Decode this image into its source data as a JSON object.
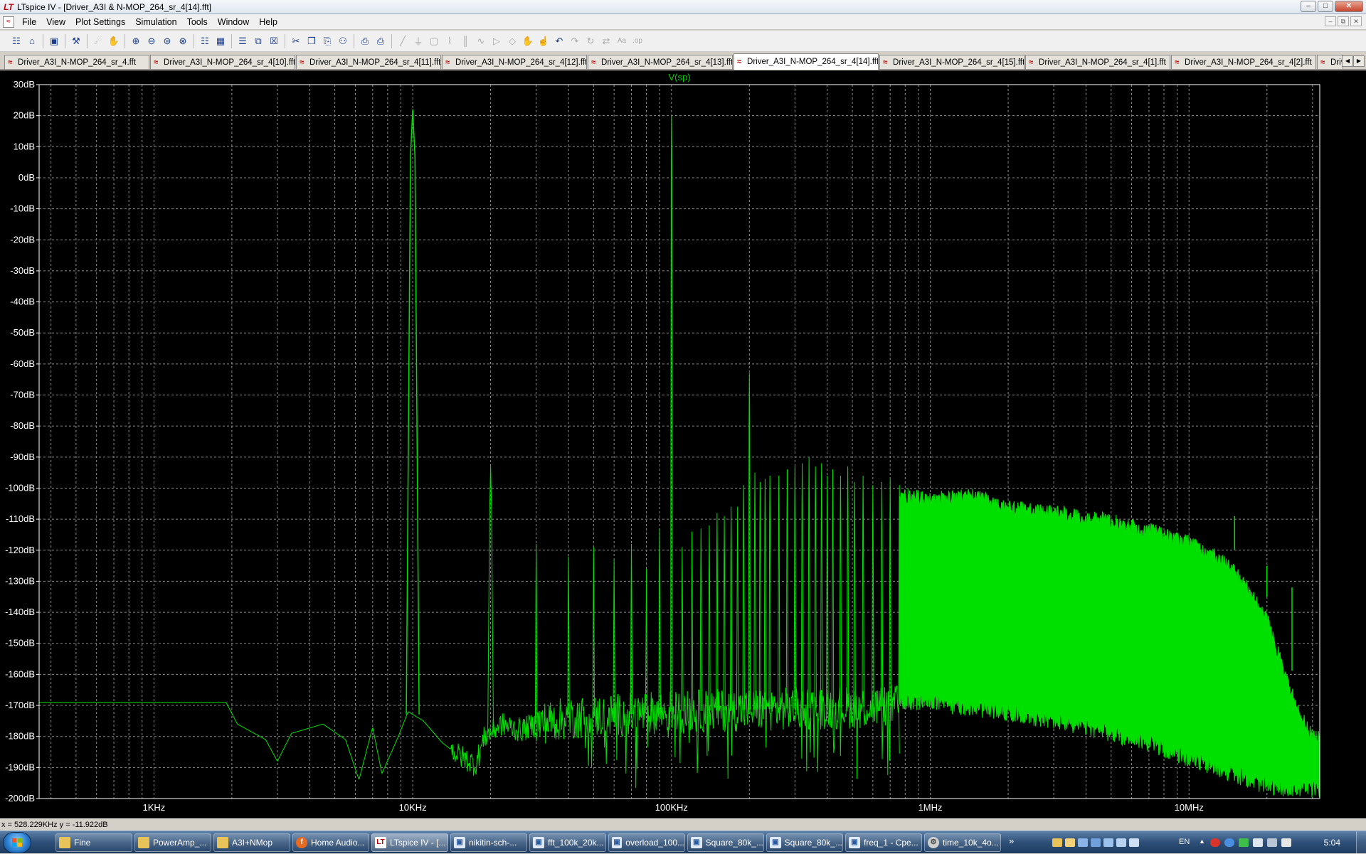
{
  "window": {
    "title": "LTspice IV - [Driver_A3I & N-MOP_264_sr_4[14].fft]",
    "app_icon": "ltspice-logo-icon"
  },
  "menu": [
    "File",
    "View",
    "Plot Settings",
    "Simulation",
    "Tools",
    "Window",
    "Help"
  ],
  "toolbar": {
    "groups": [
      [
        "new-schematic-icon",
        "open-icon"
      ],
      [
        "save-icon"
      ],
      [
        "control-panel-icon"
      ],
      [
        "run-icon",
        "halt-icon"
      ],
      [
        "zoom-in-icon",
        "zoom-out-icon",
        "zoom-fit-icon",
        "zoom-cancel-icon"
      ],
      [
        "autorange-icon",
        "grid-icon"
      ],
      [
        "tile-horizontal-icon",
        "cascade-icon",
        "close-all-icon"
      ],
      [
        "cut-icon",
        "copy-icon",
        "paste-icon",
        "find-icon"
      ],
      [
        "print-icon",
        "print-setup-icon"
      ],
      [
        "wire-icon",
        "ground-icon",
        "label-icon",
        "resistor-icon",
        "capacitor-icon",
        "inductor-icon",
        "diode-icon",
        "component-icon",
        "move-icon",
        "drag-icon",
        "undo-icon",
        "redo-icon",
        "rotate-icon",
        "mirror-icon",
        "text-icon",
        "spice-directive-icon"
      ]
    ],
    "dim_icons": [
      "run-icon",
      "halt-icon",
      "wire-icon",
      "ground-icon",
      "label-icon",
      "resistor-icon",
      "capacitor-icon",
      "inductor-icon",
      "diode-icon",
      "component-icon",
      "move-icon",
      "drag-icon",
      "redo-icon",
      "rotate-icon",
      "mirror-icon",
      "text-icon",
      "spice-directive-icon"
    ]
  },
  "tabs": [
    {
      "label": "Driver_A3I_N-MOP_264_sr_4.fft",
      "active": false
    },
    {
      "label": "Driver_A3I_N-MOP_264_sr_4[10].fft",
      "active": false
    },
    {
      "label": "Driver_A3I_N-MOP_264_sr_4[11].fft",
      "active": false
    },
    {
      "label": "Driver_A3I_N-MOP_264_sr_4[12].fft",
      "active": false
    },
    {
      "label": "Driver_A3I_N-MOP_264_sr_4[13].fft",
      "active": false
    },
    {
      "label": "Driver_A3I_N-MOP_264_sr_4[14].fft",
      "active": true
    },
    {
      "label": "Driver_A3I_N-MOP_264_sr_4[15].fft",
      "active": false
    },
    {
      "label": "Driver_A3I_N-MOP_264_sr_4[1].fft",
      "active": false
    },
    {
      "label": "Driver_A3I_N-MOP_264_sr_4[2].fft",
      "active": false
    },
    {
      "label": "Driver_...",
      "active": false
    }
  ],
  "chart_data": {
    "type": "line",
    "title": "V(sp)",
    "xlabel": "",
    "ylabel": "",
    "x_scale": "log",
    "xlim_hz": [
      360,
      32000000
    ],
    "ylim_db": [
      -200,
      30
    ],
    "xticks": [
      {
        "value": 1000,
        "label": "1KHz"
      },
      {
        "value": 10000,
        "label": "10KHz"
      },
      {
        "value": 100000,
        "label": "100KHz"
      },
      {
        "value": 1000000,
        "label": "1MHz"
      },
      {
        "value": 10000000,
        "label": "10MHz"
      }
    ],
    "yticks": [
      {
        "value": 30,
        "label": "30dB"
      },
      {
        "value": 20,
        "label": "20dB"
      },
      {
        "value": 10,
        "label": "10dB"
      },
      {
        "value": 0,
        "label": "0dB"
      },
      {
        "value": -10,
        "label": "-10dB"
      },
      {
        "value": -20,
        "label": "-20dB"
      },
      {
        "value": -30,
        "label": "-30dB"
      },
      {
        "value": -40,
        "label": "-40dB"
      },
      {
        "value": -50,
        "label": "-50dB"
      },
      {
        "value": -60,
        "label": "-60dB"
      },
      {
        "value": -70,
        "label": "-70dB"
      },
      {
        "value": -80,
        "label": "-80dB"
      },
      {
        "value": -90,
        "label": "-90dB"
      },
      {
        "value": -100,
        "label": "-100dB"
      },
      {
        "value": -110,
        "label": "-110dB"
      },
      {
        "value": -120,
        "label": "-120dB"
      },
      {
        "value": -130,
        "label": "-130dB"
      },
      {
        "value": -140,
        "label": "-140dB"
      },
      {
        "value": -150,
        "label": "-150dB"
      },
      {
        "value": -160,
        "label": "-160dB"
      },
      {
        "value": -170,
        "label": "-170dB"
      },
      {
        "value": -180,
        "label": "-180dB"
      },
      {
        "value": -190,
        "label": "-190dB"
      },
      {
        "value": -200,
        "label": "-200dB"
      }
    ],
    "grid": true,
    "colors": {
      "background": "#000000",
      "trace": "#00e000",
      "grid": "#8a8a8a",
      "axis_text": "#ffffff",
      "title": "#00d000"
    },
    "series": [
      {
        "name": "V(sp)",
        "noise_floor": [
          [
            360,
            -169
          ],
          [
            1000,
            -169
          ],
          [
            1900,
            -169
          ],
          [
            2100,
            -176
          ],
          [
            2700,
            -181
          ],
          [
            3000,
            -188
          ],
          [
            3400,
            -179
          ],
          [
            4500,
            -176
          ],
          [
            5500,
            -181
          ],
          [
            6200,
            -194
          ],
          [
            7000,
            -177
          ],
          [
            7600,
            -192
          ],
          [
            8800,
            -180
          ],
          [
            9600,
            -172
          ],
          [
            11000,
            -175
          ],
          [
            13000,
            -182
          ],
          [
            15000,
            -186
          ],
          [
            17500,
            -189
          ],
          [
            19000,
            -180
          ],
          [
            22000,
            -176
          ],
          [
            26000,
            -178
          ],
          [
            30000,
            -176
          ],
          [
            40000,
            -174
          ],
          [
            100000,
            -172
          ],
          [
            300000,
            -171
          ],
          [
            1000000,
            -170
          ],
          [
            3000000,
            -170
          ],
          [
            10000000,
            -170
          ],
          [
            20000000,
            -174
          ],
          [
            32000000,
            -182
          ]
        ],
        "harmonic_peaks": [
          [
            10000,
            22
          ],
          [
            20000,
            -93
          ],
          [
            30000,
            -118
          ],
          [
            40000,
            -122
          ],
          [
            50000,
            -119
          ],
          [
            60000,
            -123
          ],
          [
            70000,
            -118
          ],
          [
            80000,
            -126
          ],
          [
            90000,
            -113
          ],
          [
            100000,
            20
          ],
          [
            110000,
            -119
          ],
          [
            120000,
            -114
          ],
          [
            130000,
            -113
          ],
          [
            140000,
            -112
          ],
          [
            150000,
            -108
          ],
          [
            160000,
            -109
          ],
          [
            170000,
            -106
          ],
          [
            180000,
            -106
          ],
          [
            190000,
            -99
          ],
          [
            200000,
            -63
          ],
          [
            210000,
            -95
          ],
          [
            220000,
            -98
          ],
          [
            230000,
            -97
          ],
          [
            240000,
            -96
          ],
          [
            260000,
            -96
          ],
          [
            280000,
            -94
          ],
          [
            300000,
            -93
          ],
          [
            320000,
            -92
          ],
          [
            340000,
            -90
          ],
          [
            360000,
            -93
          ],
          [
            380000,
            -92
          ],
          [
            400000,
            -96
          ],
          [
            420000,
            -94
          ],
          [
            450000,
            -96
          ],
          [
            480000,
            -93
          ],
          [
            510000,
            -98
          ],
          [
            550000,
            -96
          ],
          [
            600000,
            -99
          ],
          [
            650000,
            -98
          ],
          [
            700000,
            -97
          ],
          [
            760000,
            -99
          ],
          [
            820000,
            -100
          ],
          [
            890000,
            -101
          ],
          [
            960000,
            -102
          ]
        ],
        "dense_band_top": [
          [
            760000,
            -100
          ],
          [
            1000000,
            -101
          ],
          [
            1500000,
            -100
          ],
          [
            2000000,
            -104
          ],
          [
            3000000,
            -105
          ],
          [
            4000000,
            -107
          ],
          [
            5000000,
            -108
          ],
          [
            7000000,
            -111
          ],
          [
            10000000,
            -115
          ],
          [
            13000000,
            -120
          ],
          [
            16000000,
            -127
          ],
          [
            20000000,
            -140
          ],
          [
            23000000,
            -155
          ],
          [
            26000000,
            -168
          ],
          [
            30000000,
            -178
          ]
        ],
        "dense_band_bottom": [
          [
            760000,
            -172
          ],
          [
            1000000,
            -172
          ],
          [
            2000000,
            -175
          ],
          [
            4000000,
            -180
          ],
          [
            7000000,
            -185
          ],
          [
            10000000,
            -190
          ],
          [
            15000000,
            -195
          ],
          [
            20000000,
            -199
          ],
          [
            32000000,
            -200
          ]
        ],
        "spurs": [
          [
            15000000,
            -109
          ],
          [
            20000000,
            -125
          ],
          [
            25000000,
            -132
          ]
        ]
      }
    ]
  },
  "statusbar": {
    "cursor_text": "x = 528.229KHz    y = -11.922dB"
  },
  "taskbar": {
    "items": [
      {
        "label": "Fine",
        "icon": "folder-icon",
        "active": false
      },
      {
        "label": "PowerAmp_...",
        "icon": "folder-icon",
        "active": false
      },
      {
        "label": "A3I+NMop",
        "icon": "folder-icon",
        "active": false
      },
      {
        "label": "Home Audio...",
        "icon": "firefox-icon",
        "active": false
      },
      {
        "label": "LTspice IV - [...",
        "icon": "ltspice-icon",
        "active": true
      },
      {
        "label": "nikitin-sch-...",
        "icon": "image-viewer-icon",
        "active": false
      },
      {
        "label": "fft_100k_20k...",
        "icon": "image-viewer-icon",
        "active": false
      },
      {
        "label": "overload_100...",
        "icon": "image-viewer-icon",
        "active": false
      },
      {
        "label": "Square_80k_...",
        "icon": "image-viewer-icon",
        "active": false
      },
      {
        "label": "Square_80k_...",
        "icon": "image-viewer-icon",
        "active": false
      },
      {
        "label": "freq_1 - Cpe...",
        "icon": "image-viewer-icon",
        "active": false
      },
      {
        "label": "time_10k_4o...",
        "icon": "settings-icon",
        "active": false
      }
    ],
    "language": "EN",
    "clock": "5:04"
  }
}
